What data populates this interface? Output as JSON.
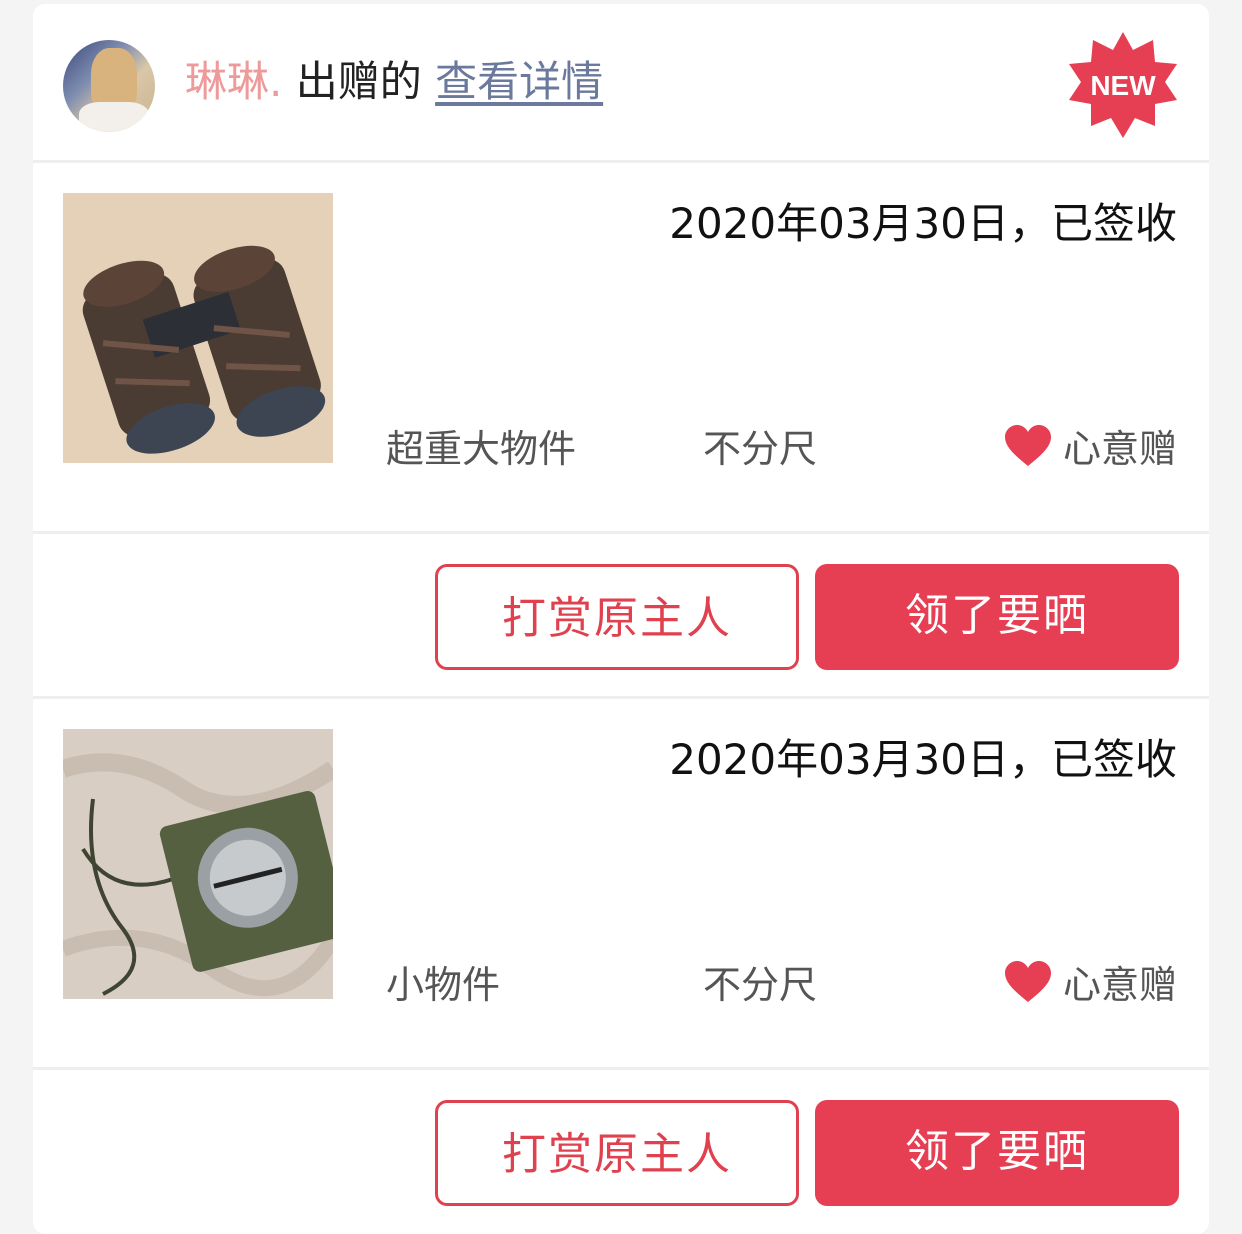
{
  "header": {
    "username": "琳琳.",
    "gave_text": "出赠的",
    "detail_link": "查看详情",
    "badge": "NEW"
  },
  "colors": {
    "accent": "#e63e52",
    "username": "#ef9a9a",
    "link": "#6b7a9c"
  },
  "items": [
    {
      "image": "binoculars-photo",
      "date_status": "2020年03月30日，已签收",
      "size_label": "超重大物件",
      "fit_label": "不分尺",
      "gift_label": "心意赠",
      "reward_button": "打赏原主人",
      "claim_button": "领了要晒"
    },
    {
      "image": "compass-photo",
      "date_status": "2020年03月30日，已签收",
      "size_label": "小物件",
      "fit_label": "不分尺",
      "gift_label": "心意赠",
      "reward_button": "打赏原主人",
      "claim_button": "领了要晒"
    }
  ]
}
